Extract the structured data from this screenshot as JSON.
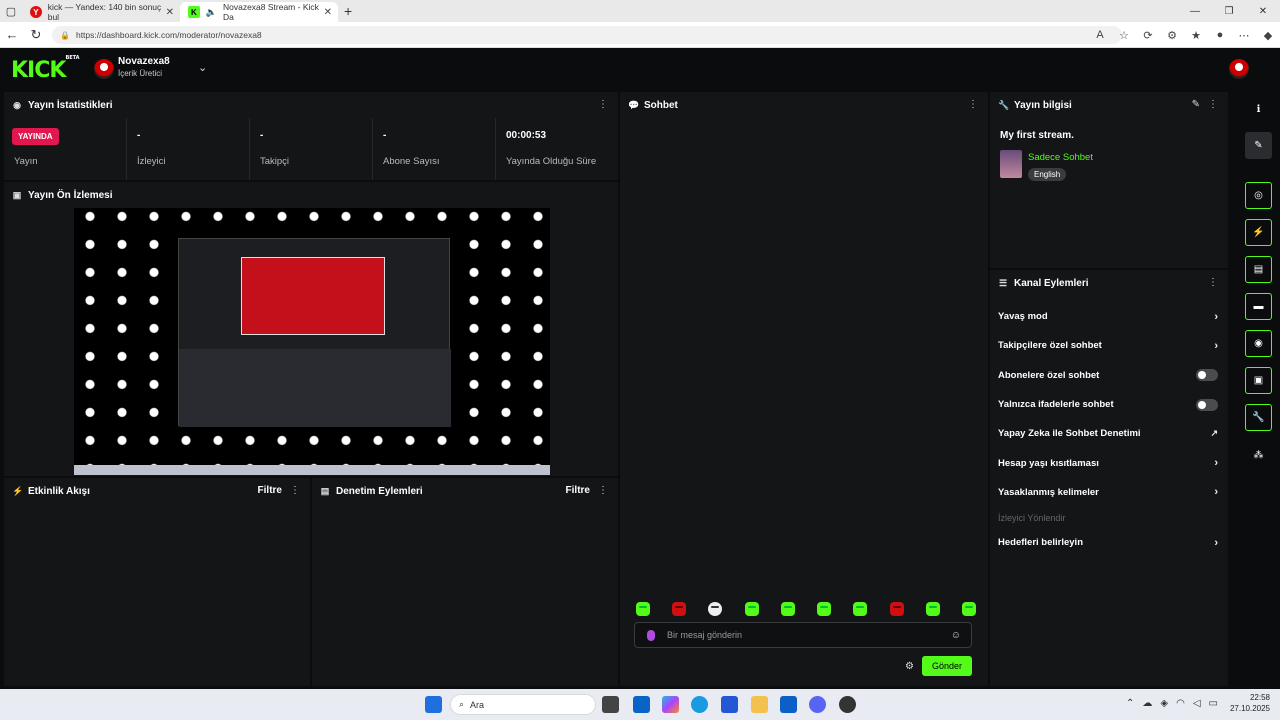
{
  "browser": {
    "tabs": [
      {
        "title": "kick — Yandex: 140 bin sonuç bul",
        "favicon": "yandex-icon",
        "active": false
      },
      {
        "title": "Novazexa8 Stream - Kick Da",
        "favicon": "kick-icon",
        "active": true
      }
    ],
    "url": "https://dashboard.kick.com/moderator/novazexa8"
  },
  "header": {
    "logo": "KICK",
    "logo_badge": "BETA",
    "user_name": "Novazexa8",
    "user_role": "İçerik Üretici"
  },
  "stats_panel": {
    "title": "Yayın İstatistikleri",
    "live_badge": "YAYINDA",
    "items": [
      {
        "value": "",
        "label": "Yayın"
      },
      {
        "value": "-",
        "label": "İzleyici"
      },
      {
        "value": "-",
        "label": "Takipçi"
      },
      {
        "value": "-",
        "label": "Abone Sayısı"
      },
      {
        "value": "00:00:53",
        "label": "Yayında Olduğu Süre"
      }
    ]
  },
  "preview_panel": {
    "title": "Yayın Ön İzlemesi"
  },
  "activity_panel": {
    "title": "Etkinlik Akışı",
    "filter": "Filtre"
  },
  "moderation_panel": {
    "title": "Denetim Eylemleri",
    "filter": "Filtre"
  },
  "chat_panel": {
    "title": "Sohbet",
    "placeholder": "Bir mesaj gönderin",
    "send": "Gönder"
  },
  "info_panel": {
    "title": "Yayın bilgisi",
    "stream_title": "My first stream.",
    "category": "Sadece Sohbet",
    "language": "English"
  },
  "actions_panel": {
    "title": "Kanal Eylemleri",
    "items": [
      {
        "label": "Yavaş mod",
        "control": "chevron"
      },
      {
        "label": "Takipçilere özel sohbet",
        "control": "chevron"
      },
      {
        "label": "Abonelere özel sohbet",
        "control": "toggle"
      },
      {
        "label": "Yalnızca ifadelerle sohbet",
        "control": "toggle"
      },
      {
        "label": "Yapay Zeka ile Sohbet Denetimi",
        "control": "external"
      },
      {
        "label": "Hesap yaşı kısıtlaması",
        "control": "chevron"
      },
      {
        "label": "Yasaklanmış kelimeler",
        "control": "chevron"
      },
      {
        "label": "İzleyici Yönlendir",
        "control": "none"
      },
      {
        "label": "Hedefleri belirleyin",
        "control": "chevron"
      }
    ]
  },
  "taskbar": {
    "search": "Ara",
    "time": "22:58",
    "date": "27.10.2025"
  },
  "colors": {
    "accent": "#53fc18",
    "live": "#e1184f",
    "panel": "#141517",
    "bg": "#0b0c0d"
  }
}
